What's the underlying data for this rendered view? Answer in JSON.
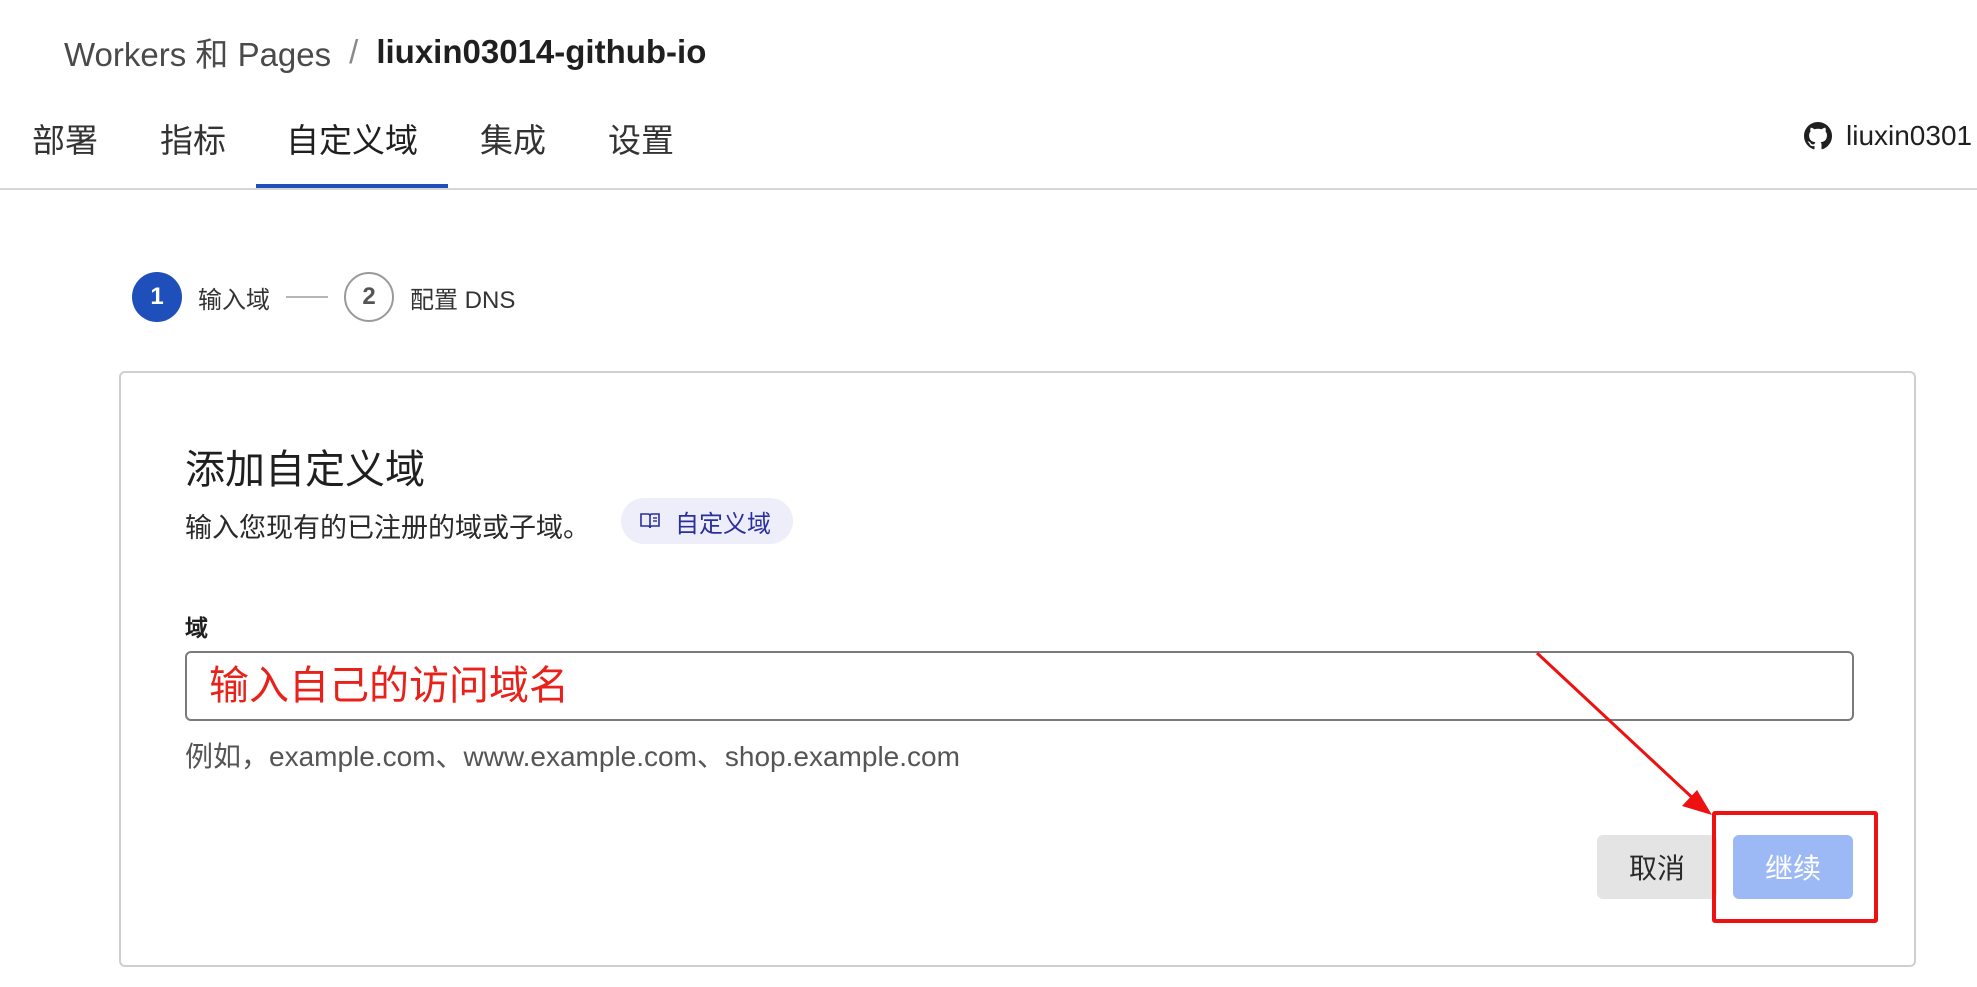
{
  "breadcrumb": {
    "parent": "Workers 和 Pages",
    "separator": "/",
    "current": "liuxin03014-github-io"
  },
  "tabs": [
    {
      "label": "部署"
    },
    {
      "label": "指标"
    },
    {
      "label": "自定义域",
      "active": true
    },
    {
      "label": "集成"
    },
    {
      "label": "设置"
    }
  ],
  "user": {
    "name": "liuxin0301",
    "icon": "github-icon"
  },
  "steps": [
    {
      "number": "1",
      "label": "输入域",
      "active": true
    },
    {
      "number": "2",
      "label": "配置 DNS",
      "active": false
    }
  ],
  "card": {
    "title": "添加自定义域",
    "description": "输入您现有的已注册的域或子域。",
    "docs_link": {
      "label": "自定义域",
      "icon": "book-icon"
    },
    "field_label": "域",
    "input": {
      "value": "",
      "placeholder": "输入自己的访问域名"
    },
    "hint": "例如，example.com、www.example.com、shop.example.com",
    "buttons": {
      "cancel": "取消",
      "continue": "继续"
    }
  },
  "colors": {
    "accent": "#1e4fbb",
    "continue_disabled": "#9cb9f6",
    "annotation": "#ee1111",
    "docs_pill_bg": "#eeeefb"
  }
}
